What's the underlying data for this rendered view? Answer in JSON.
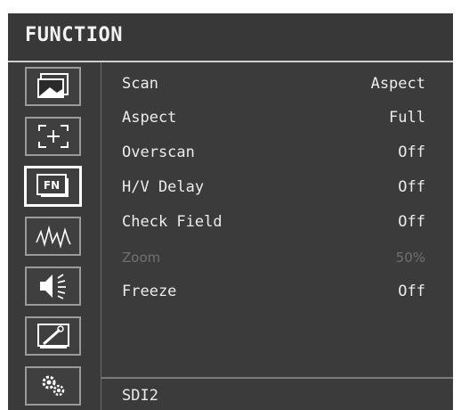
{
  "title": "FUNCTION",
  "sidebar": {
    "items": [
      {
        "name": "picture",
        "icon": "picture-icon"
      },
      {
        "name": "marker",
        "icon": "marker-icon"
      },
      {
        "name": "function",
        "icon": "fn-icon",
        "label": "FN",
        "active": true
      },
      {
        "name": "waveform",
        "icon": "waveform-icon"
      },
      {
        "name": "audio",
        "icon": "speaker-icon"
      },
      {
        "name": "display",
        "icon": "display-tools-icon"
      },
      {
        "name": "system",
        "icon": "gears-icon"
      }
    ]
  },
  "menu": {
    "items": [
      {
        "label": "Scan",
        "value": "Aspect",
        "enabled": true
      },
      {
        "label": "Aspect",
        "value": "Full",
        "enabled": true
      },
      {
        "label": "Overscan",
        "value": "Off",
        "enabled": true
      },
      {
        "label": "H/V Delay",
        "value": "Off",
        "enabled": true
      },
      {
        "label": "Check Field",
        "value": "Off",
        "enabled": true
      },
      {
        "label": "Zoom",
        "value": "50%",
        "enabled": false
      },
      {
        "label": "Freeze",
        "value": "Off",
        "enabled": true
      }
    ]
  },
  "status": {
    "input": "SDI2"
  },
  "colors": {
    "background": "#3a3a3a",
    "text": "#ececec",
    "disabled_text": "#707070",
    "active_border": "#ffffff"
  }
}
